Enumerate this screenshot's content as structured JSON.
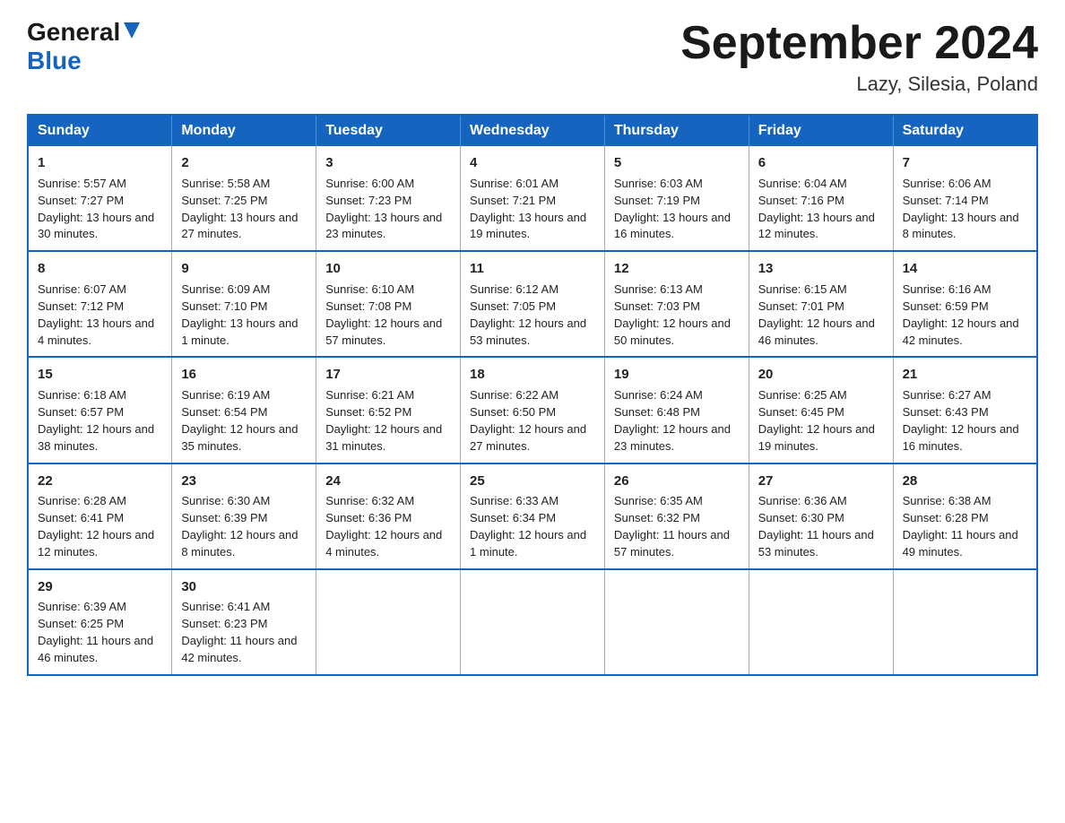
{
  "header": {
    "logo_general": "General",
    "logo_blue": "Blue",
    "month_title": "September 2024",
    "location": "Lazy, Silesia, Poland"
  },
  "weekdays": [
    "Sunday",
    "Monday",
    "Tuesday",
    "Wednesday",
    "Thursday",
    "Friday",
    "Saturday"
  ],
  "weeks": [
    [
      {
        "day": "1",
        "sunrise": "Sunrise: 5:57 AM",
        "sunset": "Sunset: 7:27 PM",
        "daylight": "Daylight: 13 hours and 30 minutes."
      },
      {
        "day": "2",
        "sunrise": "Sunrise: 5:58 AM",
        "sunset": "Sunset: 7:25 PM",
        "daylight": "Daylight: 13 hours and 27 minutes."
      },
      {
        "day": "3",
        "sunrise": "Sunrise: 6:00 AM",
        "sunset": "Sunset: 7:23 PM",
        "daylight": "Daylight: 13 hours and 23 minutes."
      },
      {
        "day": "4",
        "sunrise": "Sunrise: 6:01 AM",
        "sunset": "Sunset: 7:21 PM",
        "daylight": "Daylight: 13 hours and 19 minutes."
      },
      {
        "day": "5",
        "sunrise": "Sunrise: 6:03 AM",
        "sunset": "Sunset: 7:19 PM",
        "daylight": "Daylight: 13 hours and 16 minutes."
      },
      {
        "day": "6",
        "sunrise": "Sunrise: 6:04 AM",
        "sunset": "Sunset: 7:16 PM",
        "daylight": "Daylight: 13 hours and 12 minutes."
      },
      {
        "day": "7",
        "sunrise": "Sunrise: 6:06 AM",
        "sunset": "Sunset: 7:14 PM",
        "daylight": "Daylight: 13 hours and 8 minutes."
      }
    ],
    [
      {
        "day": "8",
        "sunrise": "Sunrise: 6:07 AM",
        "sunset": "Sunset: 7:12 PM",
        "daylight": "Daylight: 13 hours and 4 minutes."
      },
      {
        "day": "9",
        "sunrise": "Sunrise: 6:09 AM",
        "sunset": "Sunset: 7:10 PM",
        "daylight": "Daylight: 13 hours and 1 minute."
      },
      {
        "day": "10",
        "sunrise": "Sunrise: 6:10 AM",
        "sunset": "Sunset: 7:08 PM",
        "daylight": "Daylight: 12 hours and 57 minutes."
      },
      {
        "day": "11",
        "sunrise": "Sunrise: 6:12 AM",
        "sunset": "Sunset: 7:05 PM",
        "daylight": "Daylight: 12 hours and 53 minutes."
      },
      {
        "day": "12",
        "sunrise": "Sunrise: 6:13 AM",
        "sunset": "Sunset: 7:03 PM",
        "daylight": "Daylight: 12 hours and 50 minutes."
      },
      {
        "day": "13",
        "sunrise": "Sunrise: 6:15 AM",
        "sunset": "Sunset: 7:01 PM",
        "daylight": "Daylight: 12 hours and 46 minutes."
      },
      {
        "day": "14",
        "sunrise": "Sunrise: 6:16 AM",
        "sunset": "Sunset: 6:59 PM",
        "daylight": "Daylight: 12 hours and 42 minutes."
      }
    ],
    [
      {
        "day": "15",
        "sunrise": "Sunrise: 6:18 AM",
        "sunset": "Sunset: 6:57 PM",
        "daylight": "Daylight: 12 hours and 38 minutes."
      },
      {
        "day": "16",
        "sunrise": "Sunrise: 6:19 AM",
        "sunset": "Sunset: 6:54 PM",
        "daylight": "Daylight: 12 hours and 35 minutes."
      },
      {
        "day": "17",
        "sunrise": "Sunrise: 6:21 AM",
        "sunset": "Sunset: 6:52 PM",
        "daylight": "Daylight: 12 hours and 31 minutes."
      },
      {
        "day": "18",
        "sunrise": "Sunrise: 6:22 AM",
        "sunset": "Sunset: 6:50 PM",
        "daylight": "Daylight: 12 hours and 27 minutes."
      },
      {
        "day": "19",
        "sunrise": "Sunrise: 6:24 AM",
        "sunset": "Sunset: 6:48 PM",
        "daylight": "Daylight: 12 hours and 23 minutes."
      },
      {
        "day": "20",
        "sunrise": "Sunrise: 6:25 AM",
        "sunset": "Sunset: 6:45 PM",
        "daylight": "Daylight: 12 hours and 19 minutes."
      },
      {
        "day": "21",
        "sunrise": "Sunrise: 6:27 AM",
        "sunset": "Sunset: 6:43 PM",
        "daylight": "Daylight: 12 hours and 16 minutes."
      }
    ],
    [
      {
        "day": "22",
        "sunrise": "Sunrise: 6:28 AM",
        "sunset": "Sunset: 6:41 PM",
        "daylight": "Daylight: 12 hours and 12 minutes."
      },
      {
        "day": "23",
        "sunrise": "Sunrise: 6:30 AM",
        "sunset": "Sunset: 6:39 PM",
        "daylight": "Daylight: 12 hours and 8 minutes."
      },
      {
        "day": "24",
        "sunrise": "Sunrise: 6:32 AM",
        "sunset": "Sunset: 6:36 PM",
        "daylight": "Daylight: 12 hours and 4 minutes."
      },
      {
        "day": "25",
        "sunrise": "Sunrise: 6:33 AM",
        "sunset": "Sunset: 6:34 PM",
        "daylight": "Daylight: 12 hours and 1 minute."
      },
      {
        "day": "26",
        "sunrise": "Sunrise: 6:35 AM",
        "sunset": "Sunset: 6:32 PM",
        "daylight": "Daylight: 11 hours and 57 minutes."
      },
      {
        "day": "27",
        "sunrise": "Sunrise: 6:36 AM",
        "sunset": "Sunset: 6:30 PM",
        "daylight": "Daylight: 11 hours and 53 minutes."
      },
      {
        "day": "28",
        "sunrise": "Sunrise: 6:38 AM",
        "sunset": "Sunset: 6:28 PM",
        "daylight": "Daylight: 11 hours and 49 minutes."
      }
    ],
    [
      {
        "day": "29",
        "sunrise": "Sunrise: 6:39 AM",
        "sunset": "Sunset: 6:25 PM",
        "daylight": "Daylight: 11 hours and 46 minutes."
      },
      {
        "day": "30",
        "sunrise": "Sunrise: 6:41 AM",
        "sunset": "Sunset: 6:23 PM",
        "daylight": "Daylight: 11 hours and 42 minutes."
      },
      null,
      null,
      null,
      null,
      null
    ]
  ]
}
